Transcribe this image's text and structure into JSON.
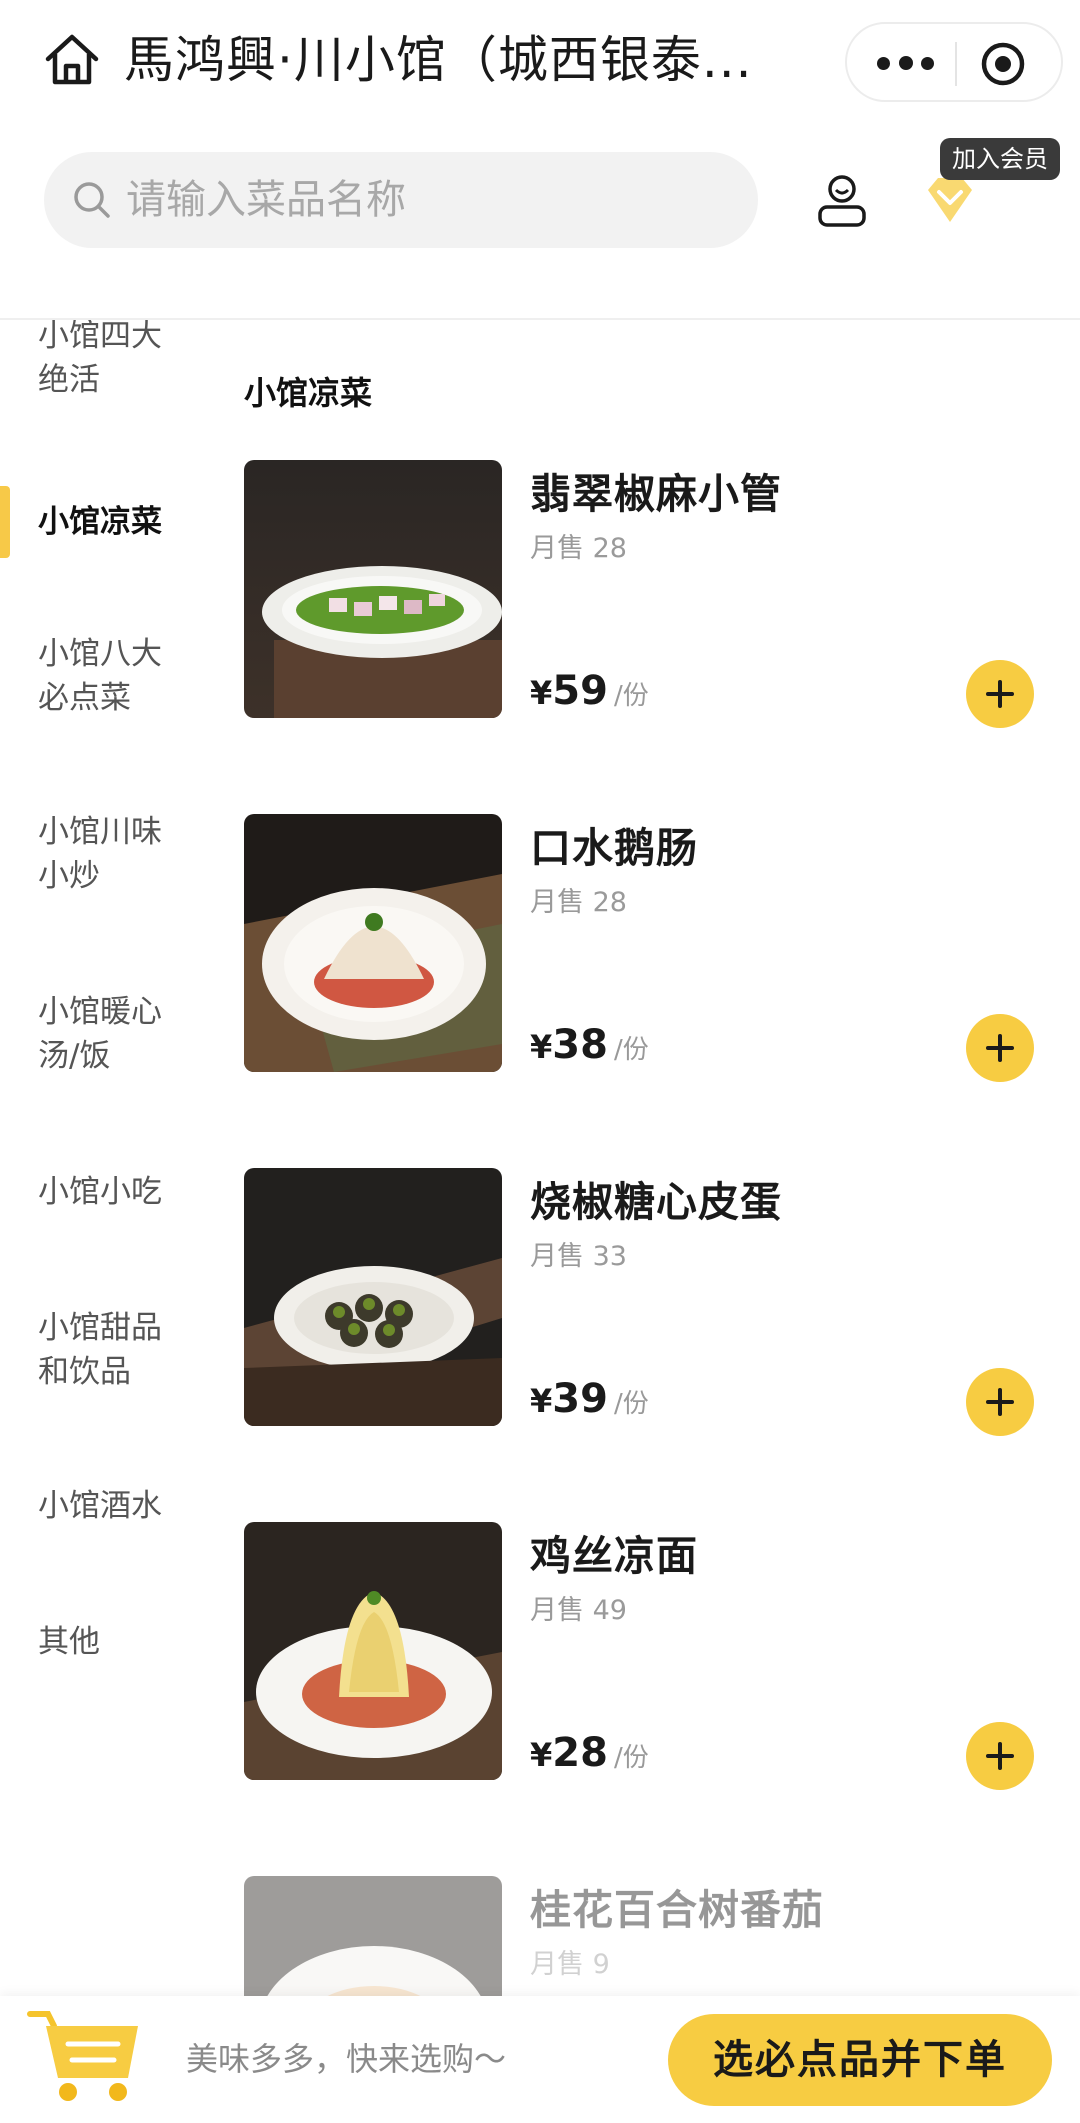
{
  "navbar": {
    "title": "馬鸿興·川小馆（城西银泰...",
    "home_icon": "home-icon",
    "more_icon": "more-dots-icon",
    "close_icon": "target-circle-icon"
  },
  "search": {
    "placeholder": "请输入菜品名称",
    "value": ""
  },
  "header_actions": {
    "user_icon": "user-icon",
    "vip_icon": "diamond-icon",
    "vip_badge": "加入会员"
  },
  "sidebar": {
    "items": [
      {
        "label": "小馆四大\n绝活",
        "active": false
      },
      {
        "label": "小馆凉菜",
        "active": true
      },
      {
        "label": "小馆八大\n必点菜",
        "active": false
      },
      {
        "label": "小馆川味\n小炒",
        "active": false
      },
      {
        "label": "小馆暖心\n汤/饭",
        "active": false
      },
      {
        "label": "小馆小吃",
        "active": false
      },
      {
        "label": "小馆甜品\n和饮品",
        "active": false
      },
      {
        "label": "小馆酒水",
        "active": false
      },
      {
        "label": "其他",
        "active": false
      }
    ]
  },
  "section": {
    "title": "小馆凉菜"
  },
  "dishes": [
    {
      "name": "翡翠椒麻小管",
      "sales": "月售 28",
      "currency": "¥",
      "price": "59",
      "unit": "/份"
    },
    {
      "name": "口水鹅肠",
      "sales": "月售 28",
      "currency": "¥",
      "price": "38",
      "unit": "/份"
    },
    {
      "name": "烧椒糖心皮蛋",
      "sales": "月售 33",
      "currency": "¥",
      "price": "39",
      "unit": "/份"
    },
    {
      "name": "鸡丝凉面",
      "sales": "月售 49",
      "currency": "¥",
      "price": "28",
      "unit": "/份"
    },
    {
      "name": "桂花百合树番茄",
      "sales": "月售 9",
      "currency": "¥",
      "price": "",
      "unit": ""
    }
  ],
  "cart": {
    "icon": "shopping-cart-icon",
    "hint": "美味多多，快来选购～",
    "checkout_label": "选必点品并下单"
  },
  "colors": {
    "accent": "#f7cc42",
    "active_bar": "#f7c948",
    "text_main": "#1a1a1a",
    "text_muted": "#9a9a9a",
    "search_bg": "#f2f2f2"
  }
}
